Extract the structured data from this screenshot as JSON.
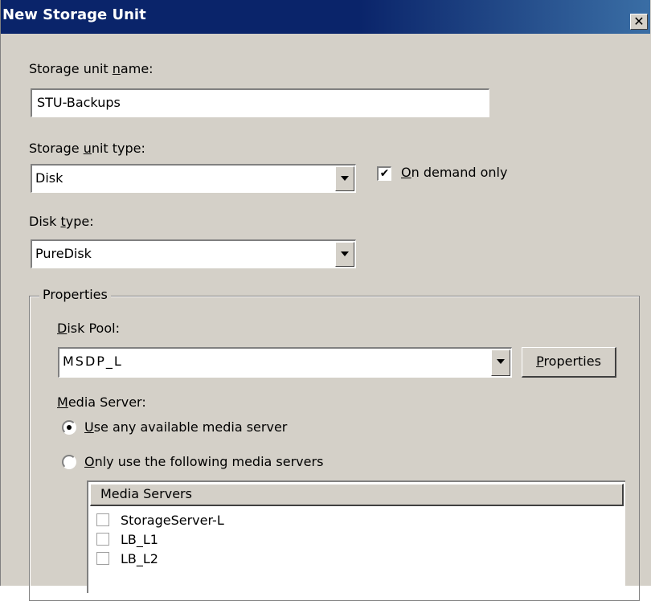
{
  "window": {
    "title": "New Storage Unit",
    "close_glyph": "✕"
  },
  "storage_unit_name": {
    "label_pre": "Storage unit ",
    "label_key": "n",
    "label_post": "ame:",
    "value": "STU-Backups"
  },
  "storage_unit_type": {
    "label_pre": "Storage ",
    "label_key": "u",
    "label_post": "nit type:",
    "value": "Disk"
  },
  "on_demand_only": {
    "checked": true,
    "check_glyph": "✔",
    "label_key": "O",
    "label_post": "n demand only"
  },
  "disk_type": {
    "label_pre": "Disk ",
    "label_key": "t",
    "label_post": "ype:",
    "value": "PureDisk"
  },
  "properties_group": {
    "title": "Properties",
    "disk_pool": {
      "label_key": "D",
      "label_post": "isk Pool:",
      "value": "MSDP_L"
    },
    "properties_button": {
      "label_key": "P",
      "label_post": "roperties"
    },
    "media_server": {
      "label_key": "M",
      "label_post": "edia Server:",
      "options": [
        {
          "key": "U",
          "rest": "se any available media server",
          "selected": true
        },
        {
          "key": "O",
          "rest": "nly use the following media servers",
          "selected": false
        }
      ]
    },
    "media_servers_list": {
      "header": "Media Servers",
      "rows": [
        "StorageServer-L",
        "LB_L1",
        "LB_L2"
      ]
    }
  }
}
